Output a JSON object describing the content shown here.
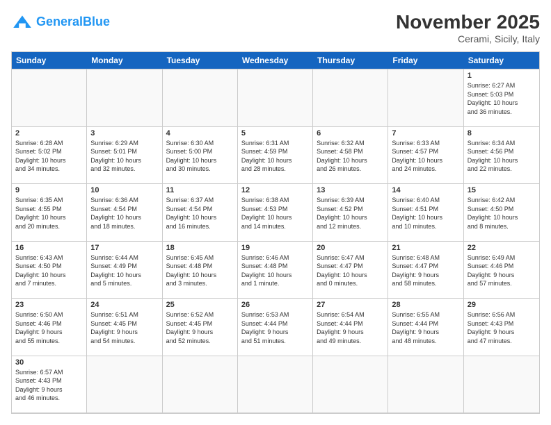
{
  "header": {
    "logo_general": "General",
    "logo_blue": "Blue",
    "title": "November 2025",
    "location": "Cerami, Sicily, Italy"
  },
  "days": [
    "Sunday",
    "Monday",
    "Tuesday",
    "Wednesday",
    "Thursday",
    "Friday",
    "Saturday"
  ],
  "cells": [
    {
      "day": "",
      "empty": true,
      "info": ""
    },
    {
      "day": "",
      "empty": true,
      "info": ""
    },
    {
      "day": "",
      "empty": true,
      "info": ""
    },
    {
      "day": "",
      "empty": true,
      "info": ""
    },
    {
      "day": "",
      "empty": true,
      "info": ""
    },
    {
      "day": "",
      "empty": true,
      "info": ""
    },
    {
      "day": "1",
      "empty": false,
      "info": "Sunrise: 6:27 AM\nSunset: 5:03 PM\nDaylight: 10 hours\nand 36 minutes."
    },
    {
      "day": "2",
      "empty": false,
      "info": "Sunrise: 6:28 AM\nSunset: 5:02 PM\nDaylight: 10 hours\nand 34 minutes."
    },
    {
      "day": "3",
      "empty": false,
      "info": "Sunrise: 6:29 AM\nSunset: 5:01 PM\nDaylight: 10 hours\nand 32 minutes."
    },
    {
      "day": "4",
      "empty": false,
      "info": "Sunrise: 6:30 AM\nSunset: 5:00 PM\nDaylight: 10 hours\nand 30 minutes."
    },
    {
      "day": "5",
      "empty": false,
      "info": "Sunrise: 6:31 AM\nSunset: 4:59 PM\nDaylight: 10 hours\nand 28 minutes."
    },
    {
      "day": "6",
      "empty": false,
      "info": "Sunrise: 6:32 AM\nSunset: 4:58 PM\nDaylight: 10 hours\nand 26 minutes."
    },
    {
      "day": "7",
      "empty": false,
      "info": "Sunrise: 6:33 AM\nSunset: 4:57 PM\nDaylight: 10 hours\nand 24 minutes."
    },
    {
      "day": "8",
      "empty": false,
      "info": "Sunrise: 6:34 AM\nSunset: 4:56 PM\nDaylight: 10 hours\nand 22 minutes."
    },
    {
      "day": "9",
      "empty": false,
      "info": "Sunrise: 6:35 AM\nSunset: 4:55 PM\nDaylight: 10 hours\nand 20 minutes."
    },
    {
      "day": "10",
      "empty": false,
      "info": "Sunrise: 6:36 AM\nSunset: 4:54 PM\nDaylight: 10 hours\nand 18 minutes."
    },
    {
      "day": "11",
      "empty": false,
      "info": "Sunrise: 6:37 AM\nSunset: 4:54 PM\nDaylight: 10 hours\nand 16 minutes."
    },
    {
      "day": "12",
      "empty": false,
      "info": "Sunrise: 6:38 AM\nSunset: 4:53 PM\nDaylight: 10 hours\nand 14 minutes."
    },
    {
      "day": "13",
      "empty": false,
      "info": "Sunrise: 6:39 AM\nSunset: 4:52 PM\nDaylight: 10 hours\nand 12 minutes."
    },
    {
      "day": "14",
      "empty": false,
      "info": "Sunrise: 6:40 AM\nSunset: 4:51 PM\nDaylight: 10 hours\nand 10 minutes."
    },
    {
      "day": "15",
      "empty": false,
      "info": "Sunrise: 6:42 AM\nSunset: 4:50 PM\nDaylight: 10 hours\nand 8 minutes."
    },
    {
      "day": "16",
      "empty": false,
      "info": "Sunrise: 6:43 AM\nSunset: 4:50 PM\nDaylight: 10 hours\nand 7 minutes."
    },
    {
      "day": "17",
      "empty": false,
      "info": "Sunrise: 6:44 AM\nSunset: 4:49 PM\nDaylight: 10 hours\nand 5 minutes."
    },
    {
      "day": "18",
      "empty": false,
      "info": "Sunrise: 6:45 AM\nSunset: 4:48 PM\nDaylight: 10 hours\nand 3 minutes."
    },
    {
      "day": "19",
      "empty": false,
      "info": "Sunrise: 6:46 AM\nSunset: 4:48 PM\nDaylight: 10 hours\nand 1 minute."
    },
    {
      "day": "20",
      "empty": false,
      "info": "Sunrise: 6:47 AM\nSunset: 4:47 PM\nDaylight: 10 hours\nand 0 minutes."
    },
    {
      "day": "21",
      "empty": false,
      "info": "Sunrise: 6:48 AM\nSunset: 4:47 PM\nDaylight: 9 hours\nand 58 minutes."
    },
    {
      "day": "22",
      "empty": false,
      "info": "Sunrise: 6:49 AM\nSunset: 4:46 PM\nDaylight: 9 hours\nand 57 minutes."
    },
    {
      "day": "23",
      "empty": false,
      "info": "Sunrise: 6:50 AM\nSunset: 4:46 PM\nDaylight: 9 hours\nand 55 minutes."
    },
    {
      "day": "24",
      "empty": false,
      "info": "Sunrise: 6:51 AM\nSunset: 4:45 PM\nDaylight: 9 hours\nand 54 minutes."
    },
    {
      "day": "25",
      "empty": false,
      "info": "Sunrise: 6:52 AM\nSunset: 4:45 PM\nDaylight: 9 hours\nand 52 minutes."
    },
    {
      "day": "26",
      "empty": false,
      "info": "Sunrise: 6:53 AM\nSunset: 4:44 PM\nDaylight: 9 hours\nand 51 minutes."
    },
    {
      "day": "27",
      "empty": false,
      "info": "Sunrise: 6:54 AM\nSunset: 4:44 PM\nDaylight: 9 hours\nand 49 minutes."
    },
    {
      "day": "28",
      "empty": false,
      "info": "Sunrise: 6:55 AM\nSunset: 4:44 PM\nDaylight: 9 hours\nand 48 minutes."
    },
    {
      "day": "29",
      "empty": false,
      "info": "Sunrise: 6:56 AM\nSunset: 4:43 PM\nDaylight: 9 hours\nand 47 minutes."
    },
    {
      "day": "30",
      "empty": false,
      "info": "Sunrise: 6:57 AM\nSunset: 4:43 PM\nDaylight: 9 hours\nand 46 minutes."
    },
    {
      "day": "",
      "empty": true,
      "info": ""
    },
    {
      "day": "",
      "empty": true,
      "info": ""
    },
    {
      "day": "",
      "empty": true,
      "info": ""
    },
    {
      "day": "",
      "empty": true,
      "info": ""
    },
    {
      "day": "",
      "empty": true,
      "info": ""
    },
    {
      "day": "",
      "empty": true,
      "info": ""
    }
  ]
}
